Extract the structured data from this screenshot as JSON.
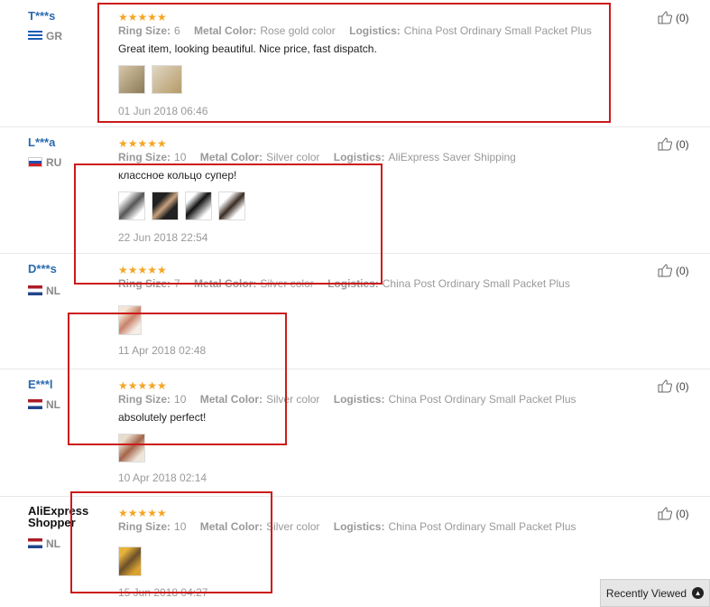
{
  "labels": {
    "ring_size": "Ring Size:",
    "metal_color": "Metal Color:",
    "logistics": "Logistics:",
    "stars": "★★★★★"
  },
  "reviews": [
    {
      "user": "T***s",
      "country": "GR",
      "ring_size": "6",
      "metal_color": "Rose gold color",
      "logistics": "China Post Ordinary Small Packet Plus",
      "text": "Great item, looking beautiful. Nice price, fast dispatch.",
      "date": "01 Jun 2018 06:46",
      "helpful": "(0)"
    },
    {
      "user": "L***a",
      "country": "RU",
      "ring_size": "10",
      "metal_color": "Silver color",
      "logistics": "AliExpress Saver Shipping",
      "text": "классное кольцо супер!",
      "date": "22 Jun 2018 22:54",
      "helpful": "(0)"
    },
    {
      "user": "D***s",
      "country": "NL",
      "ring_size": "7",
      "metal_color": "Silver color",
      "logistics": "China Post Ordinary Small Packet Plus",
      "text": "",
      "date": "11 Apr 2018 02:48",
      "helpful": "(0)"
    },
    {
      "user": "E***l",
      "country": "NL",
      "ring_size": "10",
      "metal_color": "Silver color",
      "logistics": "China Post Ordinary Small Packet Plus",
      "text": "absolutely perfect!",
      "date": "10 Apr 2018 02:14",
      "helpful": "(0)"
    },
    {
      "user": "AliExpress Shopper",
      "country": "NL",
      "ring_size": "10",
      "metal_color": "Silver color",
      "logistics": "China Post Ordinary Small Packet Plus",
      "text": "",
      "date": "15 Jun 2018 04:27",
      "helpful": "(0)"
    }
  ],
  "recently_viewed": "Recently Viewed",
  "colors": {
    "accent_red": "#cc1b1b",
    "star": "#f5a623",
    "username": "#2a6ab0"
  }
}
